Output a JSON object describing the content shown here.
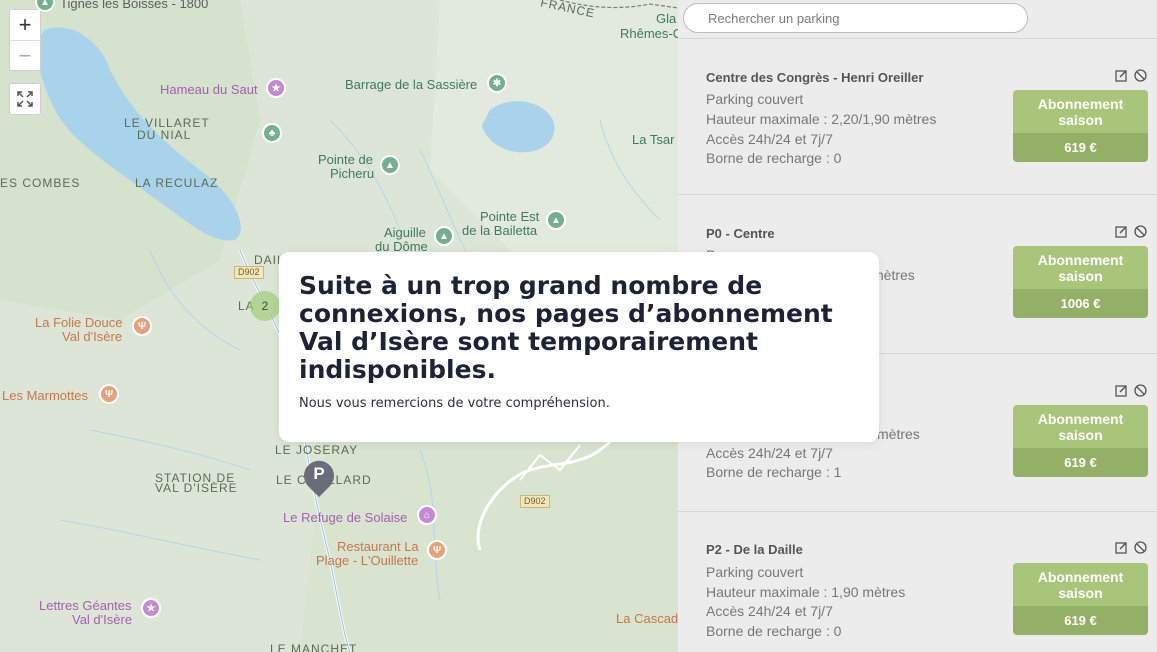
{
  "map": {
    "zoom_in_label": "+",
    "zoom_out_label": "−",
    "cluster_count": "2",
    "parking_marker_label": "P",
    "labels": [
      "LE VILLARET",
      "DU NIAL",
      "ES COMBES",
      "LA RECULAZ",
      "DAIL",
      "LA",
      "LE JOSERAY",
      "LE CR",
      "LLARD",
      "STATION DE",
      "VAL D'ISÈRE",
      "LE MANCHET",
      "FRANCE"
    ],
    "roads": [
      "D902",
      "D902",
      "D902"
    ],
    "pois": {
      "tignes": "Tignes les Boisses - 1800",
      "hameau": "Hameau du Saut",
      "barrage": "Barrage de la Sassière",
      "pointe_picheru_1": "Pointe de",
      "pointe_picheru_2": "Picheru",
      "aiguille_1": "Aiguille",
      "aiguille_2": "du Dôme",
      "pointe_est_1": "Pointe Est",
      "pointe_est_2": "de la Bailetta",
      "la_tsar": "La Tsar",
      "gla": "Gla",
      "rhemes": "Rhêmes-C",
      "folie_1": "La Folie Douce",
      "folie_2": "Val d'Isère",
      "marmottes": "Les Marmottes",
      "refuge": "Le Refuge de Solaise",
      "restaurant_1": "Restaurant La",
      "restaurant_2": "Plage - L'Ouillette",
      "lettres_1": "Lettres Géantes",
      "lettres_2": "Val d'Isère",
      "cascade": "La Cascad"
    }
  },
  "search": {
    "placeholder": "Rechercher un parking"
  },
  "parkings": [
    {
      "name": "Centre des Congrès - Henri Oreiller",
      "lines": [
        "Parking couvert",
        "Hauteur maximale : 2,20/1,90 mètres",
        "Accès 24h/24 et 7j/7",
        "Borne de recharge : 0"
      ],
      "button_label": "Abonnement saison",
      "price": "619 €"
    },
    {
      "name": "P0 - Centre",
      "lines": [
        "P",
        "mètres",
        "",
        ""
      ],
      "button_label": "Abonnement saison",
      "price": "1006 €"
    },
    {
      "name": "",
      "lines": [
        "",
        "mètres",
        "Accès 24h/24 et 7j/7",
        "Borne de recharge : 1"
      ],
      "button_label": "Abonnement saison",
      "price": "619 €"
    },
    {
      "name": "P2 - De la Daille",
      "lines": [
        "Parking couvert",
        "Hauteur maximale : 1,90 mètres",
        "Accès 24h/24 et 7j/7",
        "Borne de recharge : 0"
      ],
      "button_label": "Abonnement saison",
      "price": "619 €"
    }
  ],
  "modal": {
    "title": "Suite à un trop grand nombre de connexions, nos pages d’abonnement Val d’Isère sont temporairement indisponibles.",
    "text": "Nous vous remercions de votre compréhension."
  },
  "colors": {
    "button_green": "#a9c57a",
    "price_green": "#94b066",
    "modal_title": "#1d2236"
  }
}
